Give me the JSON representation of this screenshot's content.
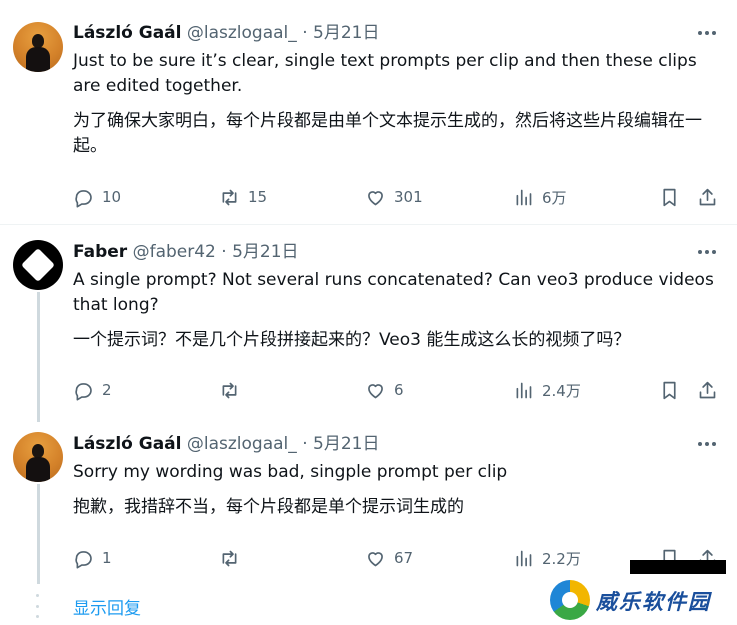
{
  "tweets": [
    {
      "name": "László Gaál",
      "handle": "@laszlogaal_",
      "sep": "·",
      "date": "5月21日",
      "text_en": "Just to be sure it’s clear, single text prompts per clip and then these clips are edited together.",
      "text_zh": "为了确保大家明白，每个片段都是由单个文本提示生成的，然后将这些片段编辑在一起。",
      "replies": "10",
      "reposts": "15",
      "likes": "301",
      "views": "6万"
    },
    {
      "name": "Faber",
      "handle": "@faber42",
      "sep": "·",
      "date": "5月21日",
      "text_en": "A single prompt? Not several runs concatenated? Can veo3 produce videos that long?",
      "text_zh": "一个提示词？不是几个片段拼接起来的？Veo3 能生成这么长的视频了吗？",
      "replies": "2",
      "reposts": "",
      "likes": "6",
      "views": "2.4万"
    },
    {
      "name": "László Gaál",
      "handle": "@laszlogaal_",
      "sep": "·",
      "date": "5月21日",
      "text_en": "Sorry my wording was bad, singple prompt per clip",
      "text_zh": "抱歉，我措辞不当，每个片段都是单个提示词生成的",
      "replies": "1",
      "reposts": "",
      "likes": "67",
      "views": "2.2万"
    }
  ],
  "show_replies": "显示回复",
  "watermark": "威乐软件园",
  "icons": [
    "more-icon",
    "reply-icon",
    "repost-icon",
    "like-icon",
    "views-icon",
    "bookmark-icon",
    "share-icon"
  ],
  "colors": {
    "text": "#0f1419",
    "muted": "#536471",
    "link": "#1d9bf0",
    "divider": "#eff3f4",
    "thread": "#cfd9de"
  }
}
